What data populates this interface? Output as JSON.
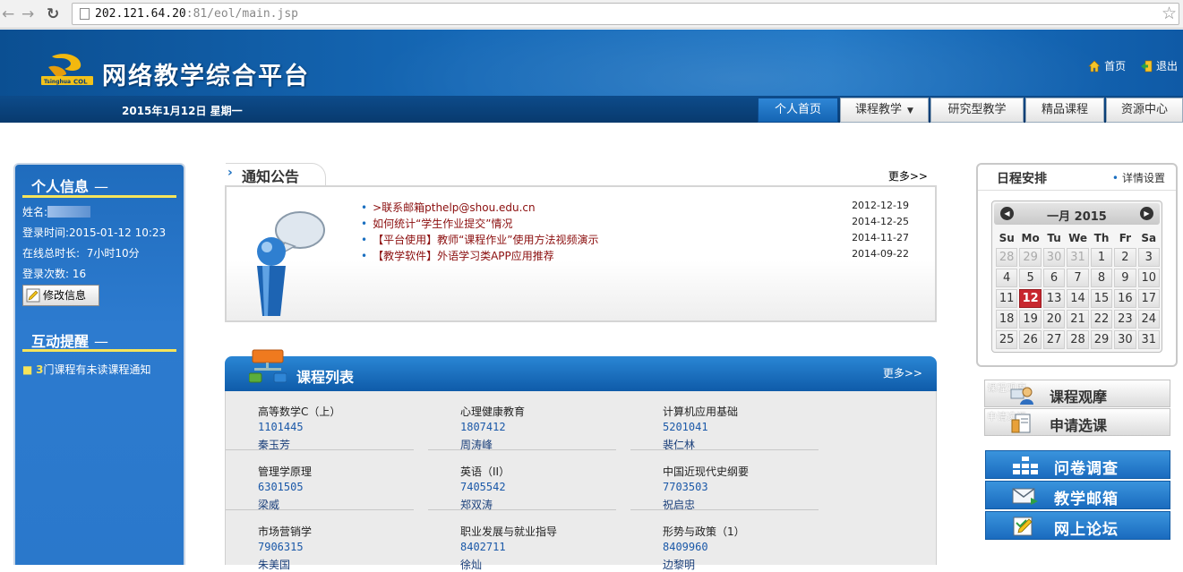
{
  "browser": {
    "url_host": "202.121.64.20",
    "url_path": ":81/eol/main.jsp"
  },
  "header": {
    "logo_text": "Tsinghua COL",
    "site_title": "网络教学综合平台",
    "date": "2015年1月12日 星期一",
    "links": [
      {
        "label": "首页",
        "icon": "home-icon"
      },
      {
        "label": "退出",
        "icon": "logout-icon"
      }
    ],
    "tabs": [
      {
        "label": "个人首页",
        "active": true
      },
      {
        "label": "课程教学",
        "dropdown": true
      },
      {
        "label": "研究型教学"
      },
      {
        "label": "精品课程"
      },
      {
        "label": "资源中心"
      }
    ]
  },
  "personal": {
    "heading": "个人信息",
    "name_label": "姓名:",
    "login_time_label": "登录时间:",
    "login_time": "2015-01-12 10:23",
    "online_label": "在线总时长:",
    "online_value": "7小时10分",
    "login_count_label": "登录次数:",
    "login_count": "16",
    "edit_button": "修改信息"
  },
  "interaction": {
    "heading": "互动提醒",
    "unread_count": "3",
    "unread_text": "门课程有未读课程通知"
  },
  "notices": {
    "heading": "通知公告",
    "more": "更多>>",
    "items": [
      {
        "title": ">联系邮箱pthelp@shou.edu.cn",
        "date": "2012-12-19"
      },
      {
        "title": "如何统计“学生作业提交”情况",
        "date": "2014-12-25"
      },
      {
        "title": "【平台使用】教师“课程作业”使用方法视频演示",
        "date": "2014-11-27"
      },
      {
        "title": "【教学软件】外语学习类APP应用推荐",
        "date": "2014-09-22"
      }
    ]
  },
  "courses": {
    "heading": "课程列表",
    "more": "更多>>",
    "items": [
      {
        "name": "高等数学C（上）",
        "code": "1101445",
        "teacher": "秦玉芳"
      },
      {
        "name": "心理健康教育",
        "code": "1807412",
        "teacher": "周涛峰"
      },
      {
        "name": "计算机应用基础",
        "code": "5201041",
        "teacher": "裴仁林"
      },
      {
        "name": "管理学原理",
        "code": "6301505",
        "teacher": "梁威"
      },
      {
        "name": "英语（II）",
        "code": "7405542",
        "teacher": "郑双涛"
      },
      {
        "name": "中国近现代史纲要",
        "code": "7703503",
        "teacher": "祝启忠"
      },
      {
        "name": "市场营销学",
        "code": "7906315",
        "teacher": "朱美国"
      },
      {
        "name": "职业发展与就业指导",
        "code": "8402711",
        "teacher": "徐灿"
      },
      {
        "name": "形势与政策（1）",
        "code": "8409960",
        "teacher": "边黎明"
      }
    ]
  },
  "schedule": {
    "heading": "日程安排",
    "settings": "详情设置",
    "month_label": "一月  2015",
    "weekdays": [
      "Su",
      "Mo",
      "Tu",
      "We",
      "Th",
      "Fr",
      "Sa"
    ],
    "weeks": [
      [
        {
          "d": "28",
          "o": true
        },
        {
          "d": "29",
          "o": true
        },
        {
          "d": "30",
          "o": true
        },
        {
          "d": "31",
          "o": true
        },
        {
          "d": "1"
        },
        {
          "d": "2"
        },
        {
          "d": "3"
        }
      ],
      [
        {
          "d": "4"
        },
        {
          "d": "5"
        },
        {
          "d": "6"
        },
        {
          "d": "7"
        },
        {
          "d": "8"
        },
        {
          "d": "9"
        },
        {
          "d": "10"
        }
      ],
      [
        {
          "d": "11"
        },
        {
          "d": "12",
          "t": true
        },
        {
          "d": "13"
        },
        {
          "d": "14"
        },
        {
          "d": "15"
        },
        {
          "d": "16"
        },
        {
          "d": "17"
        }
      ],
      [
        {
          "d": "18"
        },
        {
          "d": "19"
        },
        {
          "d": "20"
        },
        {
          "d": "21"
        },
        {
          "d": "22"
        },
        {
          "d": "23"
        },
        {
          "d": "24"
        }
      ],
      [
        {
          "d": "25"
        },
        {
          "d": "26"
        },
        {
          "d": "27"
        },
        {
          "d": "28"
        },
        {
          "d": "29"
        },
        {
          "d": "30"
        },
        {
          "d": "31"
        }
      ]
    ]
  },
  "quick_links": {
    "observe_ghost": "课程观摩",
    "observe": "课程观摩",
    "apply_ghost": "申请选课",
    "apply": "申请选课",
    "survey": "问卷调查",
    "mail": "教学邮箱",
    "forum": "网上论坛"
  }
}
